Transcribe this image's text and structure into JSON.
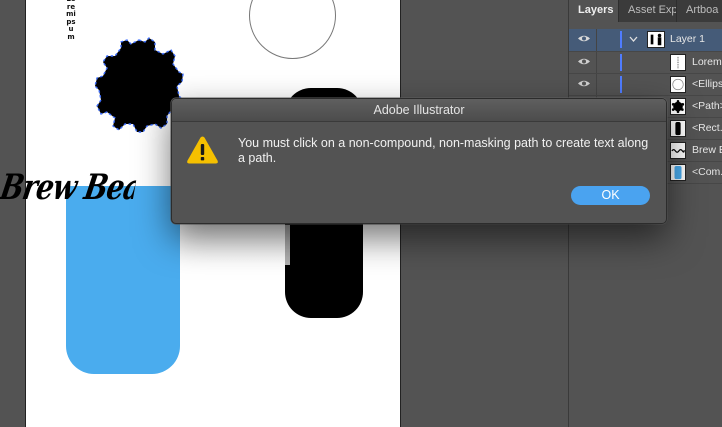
{
  "canvas": {
    "vertical_text": "Loremipsum",
    "brew_text": "Brew Beans Products"
  },
  "panel": {
    "tabs": [
      {
        "label": "Layers",
        "active": true
      },
      {
        "label": "Asset Expo",
        "active": false
      },
      {
        "label": "Artboa",
        "active": false
      }
    ],
    "layers": [
      {
        "name": "Layer 1",
        "top": true,
        "thumb": "layer"
      },
      {
        "name": "Loremipsum",
        "thumb": "text-vertical"
      },
      {
        "name": "<Ellipse>",
        "thumb": "ellipse"
      },
      {
        "name": "<Path>",
        "thumb": "gear"
      },
      {
        "name": "<Rect...>",
        "thumb": "black-rect"
      },
      {
        "name": "Brew B...",
        "thumb": "script-text"
      },
      {
        "name": "<Com...>",
        "thumb": "blue-rect"
      }
    ]
  },
  "dialog": {
    "title": "Adobe Illustrator",
    "message": "You must click on a non-compound, non-masking path to create text along a path.",
    "ok_label": "OK",
    "icon": "warning-icon"
  },
  "colors": {
    "accent_button": "#4aa3f0",
    "blue_shape": "#4aacee",
    "layer_color": "#4f7cff",
    "warning": "#f5c000"
  }
}
